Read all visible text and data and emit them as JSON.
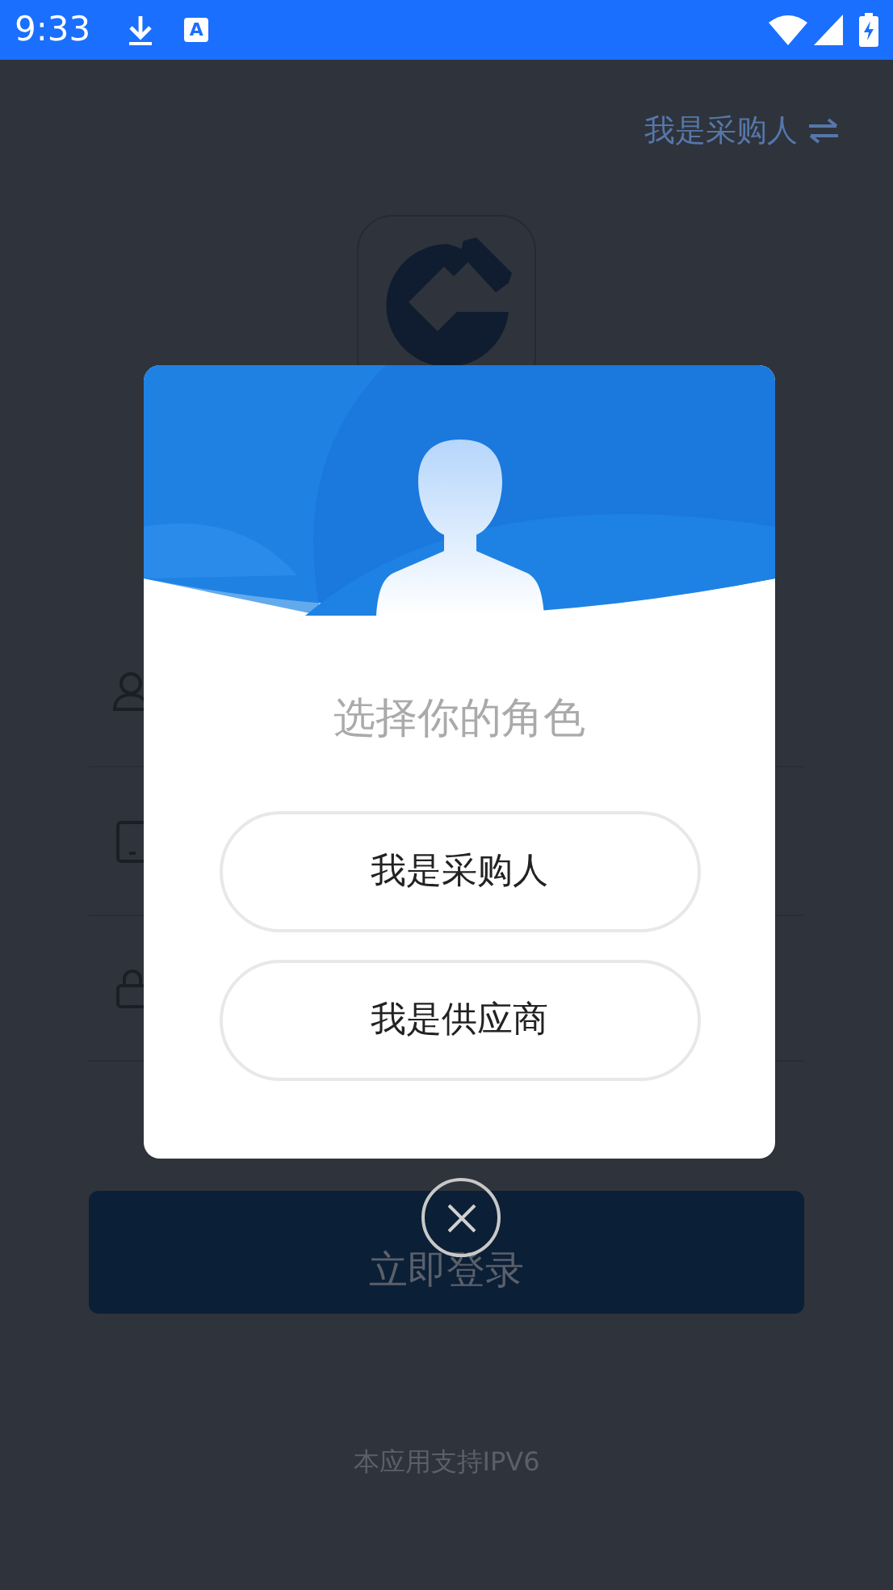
{
  "status_bar": {
    "time": "9:33",
    "notification_badge": "A"
  },
  "page": {
    "role_switch": "我是采购人",
    "login_button": "立即登录",
    "footer": "本应用支持IPV6"
  },
  "dialog": {
    "title": "选择你的角色",
    "options": [
      "我是采购人",
      "我是供应商"
    ]
  }
}
